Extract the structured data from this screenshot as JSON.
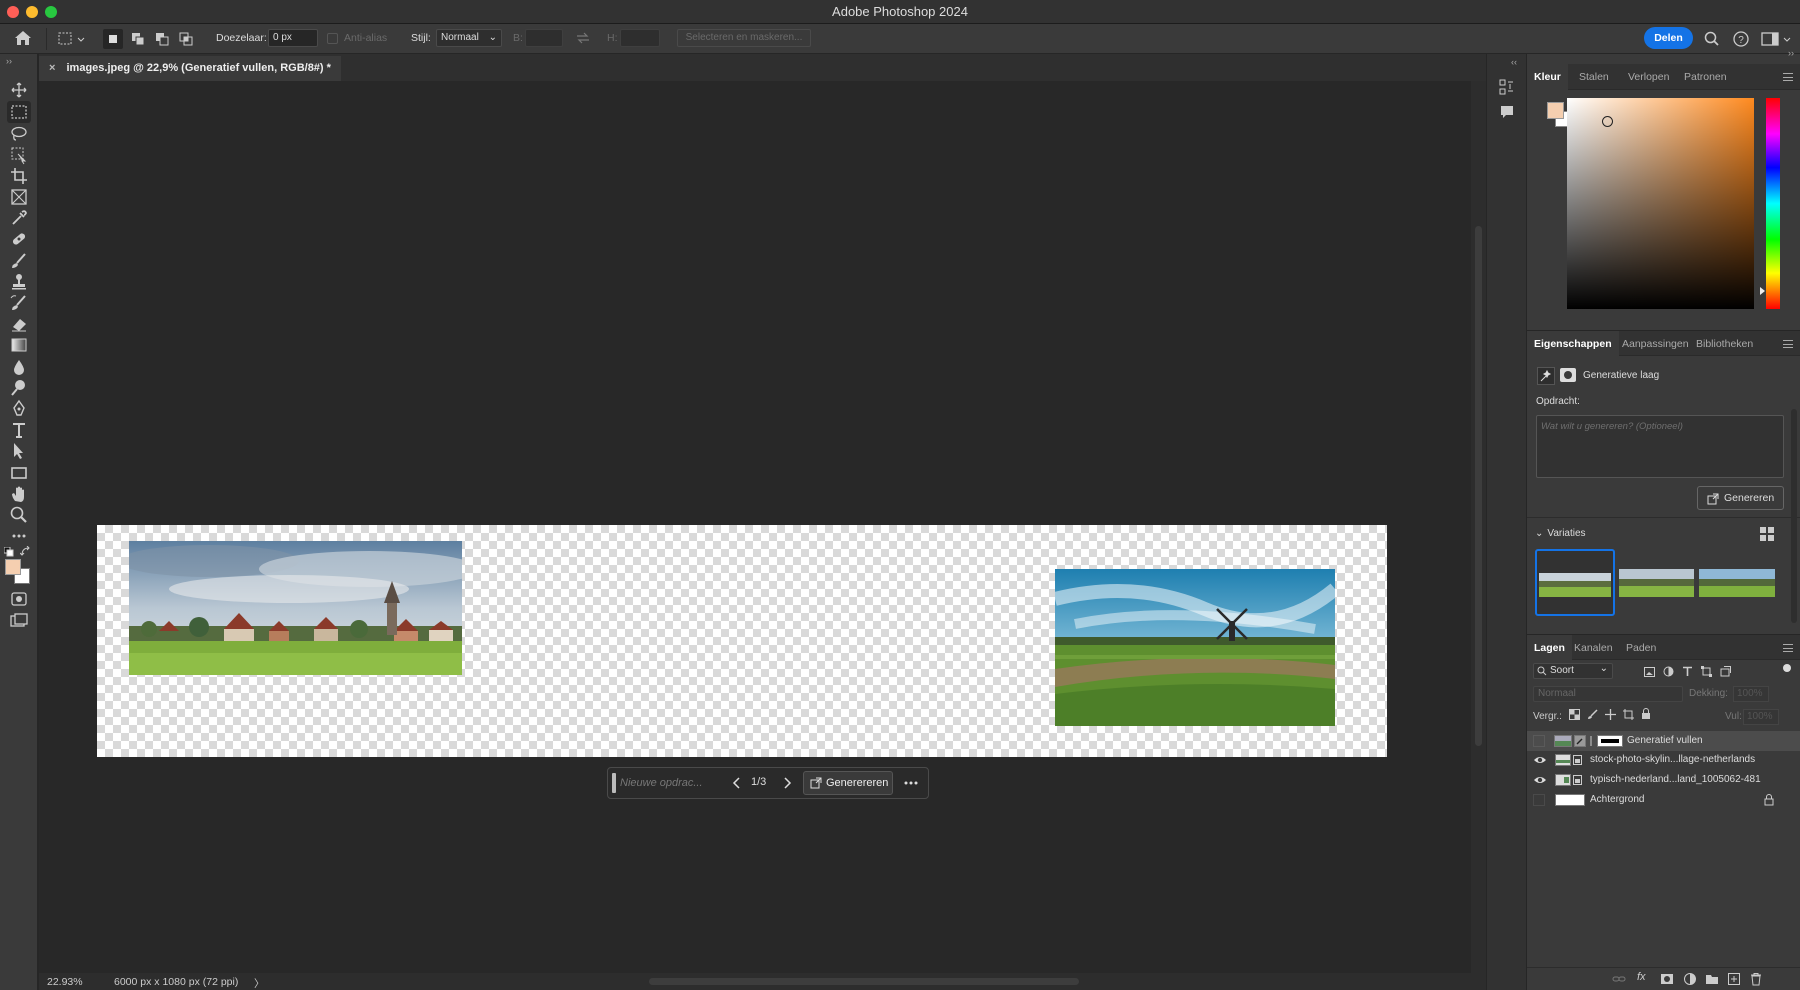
{
  "app": {
    "title": "Adobe Photoshop 2024",
    "share_button": "Delen"
  },
  "options": {
    "feather_label": "Doezelaar:",
    "feather_value": "0 px",
    "antialias_label": "Anti-alias",
    "style_label": "Stijl:",
    "style_value": "Normaal",
    "width_label": "B:",
    "height_label": "H:",
    "select_mask_button": "Selecteren en maskeren..."
  },
  "document": {
    "tab_title": "images.jpeg @ 22,9% (Generatief vullen, RGB/8#) *",
    "close_glyph": "×"
  },
  "contextual_bar": {
    "prompt_placeholder": "Nieuwe opdrac...",
    "counter": "1/3",
    "generate_button": "Generereren"
  },
  "status": {
    "zoom": "22.93%",
    "doc_info": "6000 px x 1080 px (72 ppi)",
    "arrow": "〉"
  },
  "color_panel": {
    "tabs": [
      "Kleur",
      "Stalen",
      "Verlopen",
      "Patronen"
    ],
    "active_tab": 0,
    "foreground": "#f5cfb0",
    "background": "#ffffff",
    "hue_color": "#ff8a1f"
  },
  "properties_panel": {
    "tabs": [
      "Eigenschappen",
      "Aanpassingen",
      "Bibliotheken"
    ],
    "active_tab": 0,
    "layer_type": "Generatieve laag",
    "prompt_label": "Opdracht:",
    "prompt_placeholder": "Wat wilt u genereren?  (Optioneel)",
    "generate_button": "Genereren",
    "variations_label": "Variaties"
  },
  "layers_panel": {
    "tabs": [
      "Lagen",
      "Kanalen",
      "Paden"
    ],
    "active_tab": 0,
    "filter_value": "Soort",
    "blend_mode": "Normaal",
    "opacity_label": "Dekking:",
    "opacity_value": "100%",
    "lock_label": "Vergr.:",
    "fill_label": "Vul:",
    "fill_value": "100%",
    "layers": [
      {
        "name": "Generatief vullen",
        "visible": false,
        "selected": true
      },
      {
        "name": "stock-photo-skylin...llage-netherlands",
        "visible": true,
        "selected": false
      },
      {
        "name": "typisch-nederland...land_1005062-481",
        "visible": true,
        "selected": false
      },
      {
        "name": "Achtergrond",
        "visible": false,
        "selected": false,
        "locked": true
      }
    ]
  },
  "colors": {
    "accent": "#1473e6",
    "panel_bg": "#3a3a3a",
    "canvas_bg": "#282828"
  }
}
